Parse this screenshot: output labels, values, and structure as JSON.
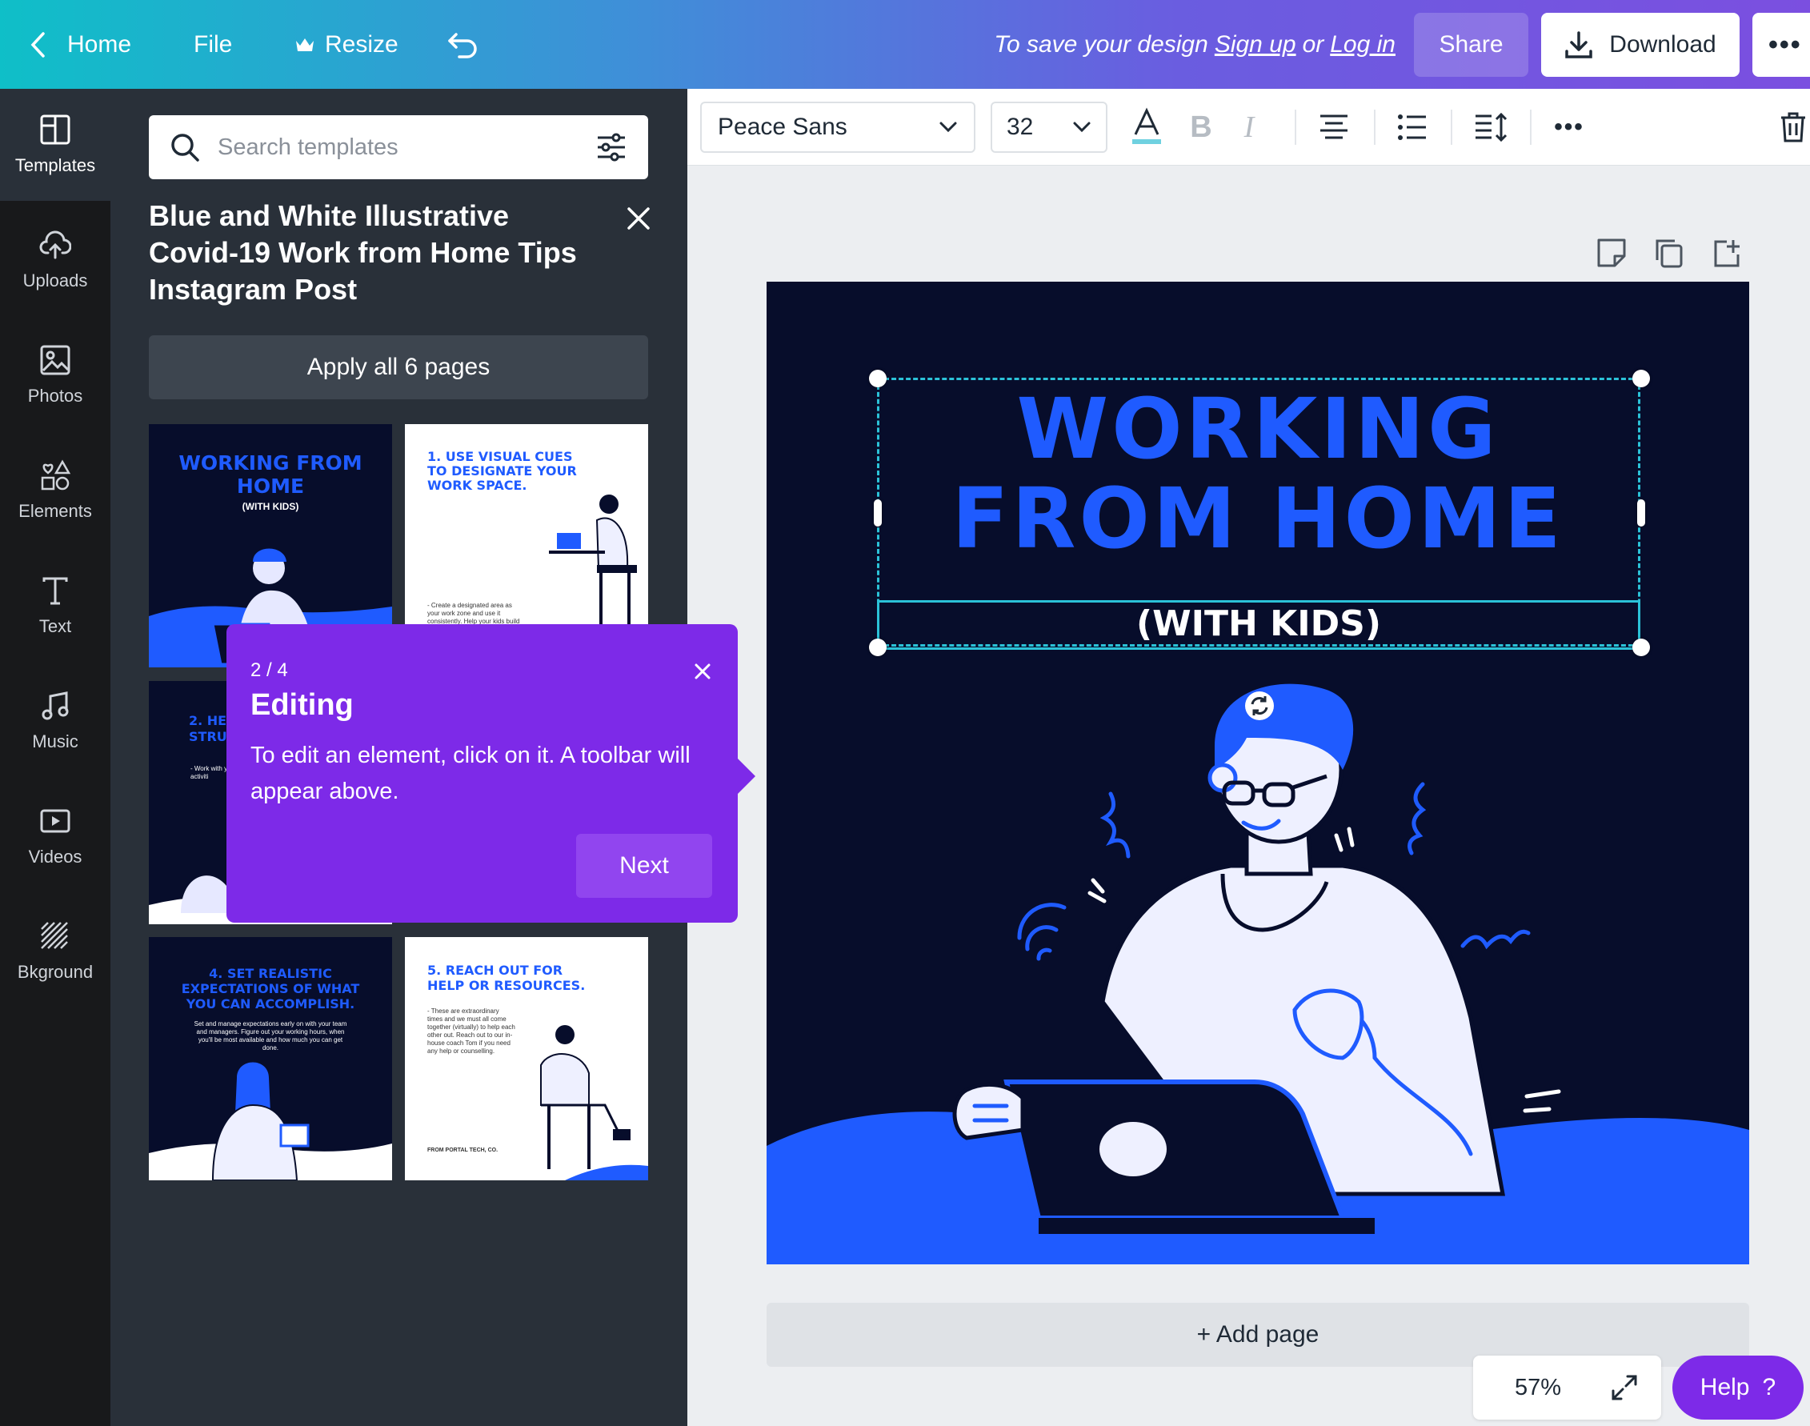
{
  "topbar": {
    "home_label": "Home",
    "file_label": "File",
    "resize_label": "Resize",
    "save_prefix": "To save your design",
    "signup_label": "Sign up",
    "or_text": "or",
    "login_label": "Log in",
    "share_label": "Share",
    "download_label": "Download"
  },
  "rail": {
    "items": [
      {
        "label": "Templates",
        "icon": "templates-icon"
      },
      {
        "label": "Uploads",
        "icon": "upload-cloud-icon"
      },
      {
        "label": "Photos",
        "icon": "photo-icon"
      },
      {
        "label": "Elements",
        "icon": "shapes-icon"
      },
      {
        "label": "Text",
        "icon": "text-icon"
      },
      {
        "label": "Music",
        "icon": "music-note-icon"
      },
      {
        "label": "Videos",
        "icon": "video-icon"
      },
      {
        "label": "Bkground",
        "icon": "background-hatch-icon"
      }
    ]
  },
  "panel": {
    "search_placeholder": "Search templates",
    "template_title": "Blue and White Illustrative Covid-19 Work from Home Tips Instagram Post",
    "apply_label": "Apply all 6 pages",
    "thumbs": [
      {
        "title": "WORKING FROM HOME",
        "sub": "(WITH KIDS)"
      },
      {
        "title": "1. USE VISUAL CUES TO DESIGNATE YOUR WORK SPACE.",
        "body": "- Create a designated area as your work zone and use it consistently. Help your kids build"
      },
      {
        "title": "2. HE RO STRUCT",
        "body": "- Work with y Give ther activiti"
      },
      {
        "title": "4. SET REALISTIC EXPECTATIONS OF WHAT YOU CAN ACCOMPLISH.",
        "body": "Set and manage expectations early on with your team and managers. Figure out your working hours, when you'll be most available and how much you can get done."
      },
      {
        "title": "5. REACH OUT FOR HELP OR RESOURCES.",
        "body": "- These are extraordinary times and we must all come together (virtually) to help each other out. Reach out to our in-house coach Tom if you need any help or counselling.",
        "footer": "FROM PORTAL TECH, CO."
      }
    ]
  },
  "toolbar": {
    "font": "Peace Sans",
    "size": "32"
  },
  "design": {
    "title_line1": "WORKING",
    "title_line2": "FROM HOME",
    "subtitle": "(WITH KIDS)",
    "accent": "#1f5bff",
    "background": "#070d2b"
  },
  "canvas": {
    "add_page_label": "+ Add page",
    "zoom": "57%",
    "help_label": "Help",
    "help_icon": "?"
  },
  "popover": {
    "step": "2 / 4",
    "title": "Editing",
    "text": "To edit an element, click on it. A toolbar will appear above.",
    "next_label": "Next"
  },
  "colors": {
    "popover": "#7d2ae8",
    "selection": "#2bc2d8",
    "panel": "#293039",
    "rail": "#18191b"
  }
}
